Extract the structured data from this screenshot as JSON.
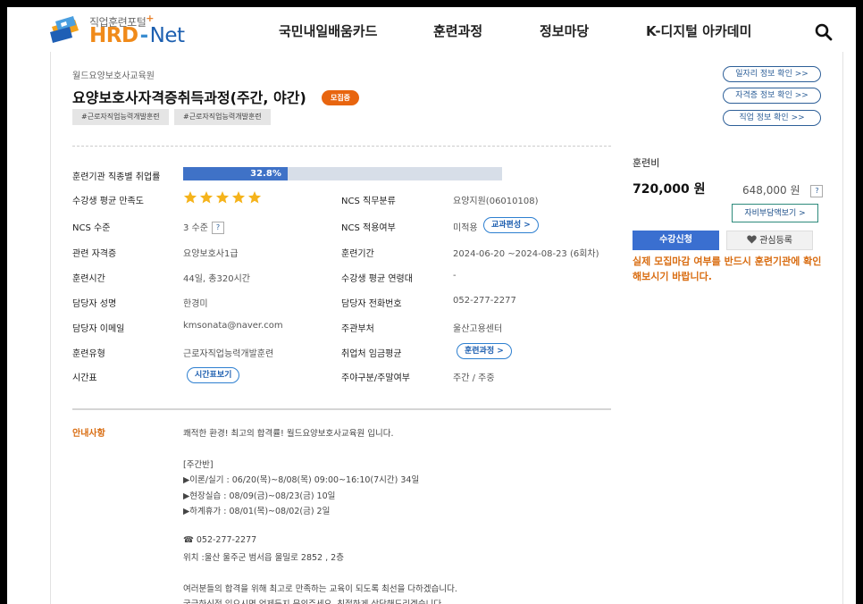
{
  "header": {
    "logo_sub": "직업훈련포털",
    "logo_plus": "+",
    "logo_hrd": "HRD",
    "logo_dash": "-",
    "logo_net": "Net",
    "nav": [
      "국민내일배움카드",
      "훈련과정",
      "정보마당",
      "K-디지털 아카데미"
    ]
  },
  "course": {
    "institution": "월드요양보호사교육원",
    "title": "요양보호사자격증취득과정(주간, 야간)",
    "status_badge": "모집중",
    "tags": [
      "#근로자직업능력개발훈련",
      "#근로자직업능력개발훈련"
    ]
  },
  "side_links": [
    "일자리 정보 확인 >>",
    "자격증 정보 확인 >>",
    "직업 정보 확인 >>"
  ],
  "employment": {
    "label": "훈련기관 직종별 취업률",
    "percent_text": "32.8%",
    "fraction": 0.328
  },
  "info": {
    "satisfaction_label": "수강생 평균 만족도",
    "stars": 5,
    "ncs_category_label": "NCS 직무분류",
    "ncs_category_value": "요양지원(06010108)",
    "ncs_level_label": "NCS 수준",
    "ncs_level_value": "3 수준",
    "ncs_level_help": "?",
    "ncs_applied_label": "NCS 적용여부",
    "ncs_applied_value": "미적용",
    "ncs_applied_button": "교과편성 >",
    "cert_label": "관련 자격증",
    "cert_value": "요양보호사1급",
    "period_label": "훈련기간",
    "period_value": "2024-06-20 ~2024-08-23 (6회차)",
    "hours_label": "훈련시간",
    "hours_value": "44일, 총320시간",
    "age_label": "수강생 평균 연령대",
    "age_value": "-",
    "manager_label": "담당자 성명",
    "manager_value": "한경미",
    "phone_label": "담당자 전화번호",
    "phone_value": "052-277-2277",
    "email_label": "담당자 이메일",
    "email_value": "kmsonata@naver.com",
    "dept_label": "주관부처",
    "dept_value": "울산고용센터",
    "type_label": "훈련유형",
    "type_value": "근로자직업능력개발훈련",
    "wage_label": "취업처 임금평균",
    "wage_button": "훈련과정 >",
    "schedule_label": "시간표",
    "schedule_button": "시간표보기",
    "daynight_label": "주야구분/주말여부",
    "daynight_value": "주간 / 주중"
  },
  "fee": {
    "label": "훈련비",
    "price": "720,000 원",
    "self_pay": "648,000 원",
    "help": "?",
    "support_button": "자비부담액보기 >",
    "apply_button": "수강신청",
    "like_button": "관심등록",
    "warning": "실제 모집마감 여부를 반드시 훈련기관에 확인해보시기 바랍니다."
  },
  "notice": {
    "label": "안내사항",
    "lines": [
      "쾌적한 환경! 최고의 합격률! 월드요양보호사교육원 입니다.",
      "",
      " [주간반]",
      "▶이론/실기 : 06/20(목)~8/08(목) 09:00~16:10(7시간) 34일",
      "▶현장실습 : 08/09(금)~08/23(금) 10일",
      "▶하계휴가 : 08/01(목)~08/02(금) 2일",
      "",
      "☎ 052-277-2277",
      "위치 :울산 울주군 범서읍 울밀로 2852 , 2층",
      "",
      "여러분들의 합격을 위해 최고로 만족하는 교육이 되도록 최선을 다하겠습니다.",
      "궁금하신점 있으시면 언제든지 문의주세요. 친절하게 상담해드리겠습니다."
    ]
  },
  "colors": {
    "accent_orange": "#e8650f",
    "primary_blue": "#3a6fd0",
    "progress_fill": "#3f72c7",
    "star": "#f5b31b"
  }
}
